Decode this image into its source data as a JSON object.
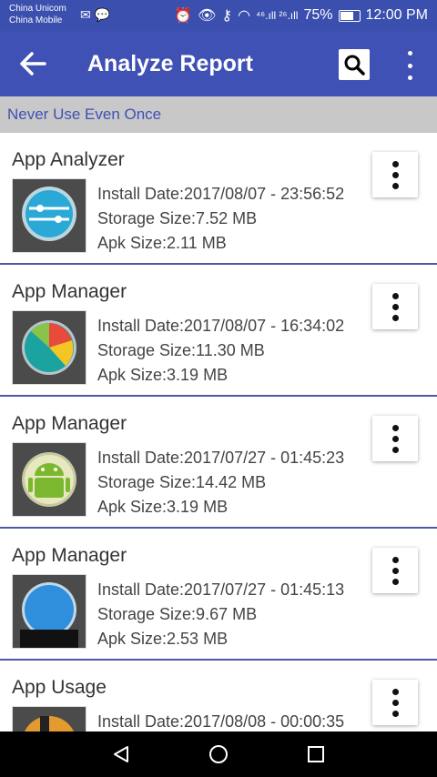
{
  "status": {
    "carrier_top": "China Unicom",
    "carrier_bottom": "China Mobile",
    "signal_labels": "⁴⁶.ıll ²⁶.ıll",
    "battery": "75%",
    "time": "12:00 PM"
  },
  "app_bar": {
    "title": "Analyze Report"
  },
  "section": {
    "title": "Never Use Even Once"
  },
  "items": [
    {
      "name": "App Analyzer",
      "install": "Install Date:2017/08/07 - 23:56:52",
      "storage": "Storage Size:7.52 MB",
      "apk": "Apk Size:2.11 MB"
    },
    {
      "name": "App Manager",
      "install": "Install Date:2017/08/07 - 16:34:02",
      "storage": "Storage Size:11.30 MB",
      "apk": "Apk Size:3.19 MB"
    },
    {
      "name": "App Manager",
      "install": "Install Date:2017/07/27 - 01:45:23",
      "storage": "Storage Size:14.42 MB",
      "apk": "Apk Size:3.19 MB"
    },
    {
      "name": "App Manager",
      "install": "Install Date:2017/07/27 - 01:45:13",
      "storage": "Storage Size:9.67 MB",
      "apk": "Apk Size:2.53 MB"
    },
    {
      "name": "App Usage",
      "install": "Install Date:2017/08/08 - 00:00:35",
      "storage": "",
      "apk": ""
    }
  ],
  "icons": {
    "back": "arrow-left-icon",
    "search": "search-icon",
    "menu": "more-vert-icon"
  },
  "colors": {
    "primary": "#3f51b5",
    "status_bar": "#3a4fae",
    "section_bg": "#c8c8c8"
  }
}
